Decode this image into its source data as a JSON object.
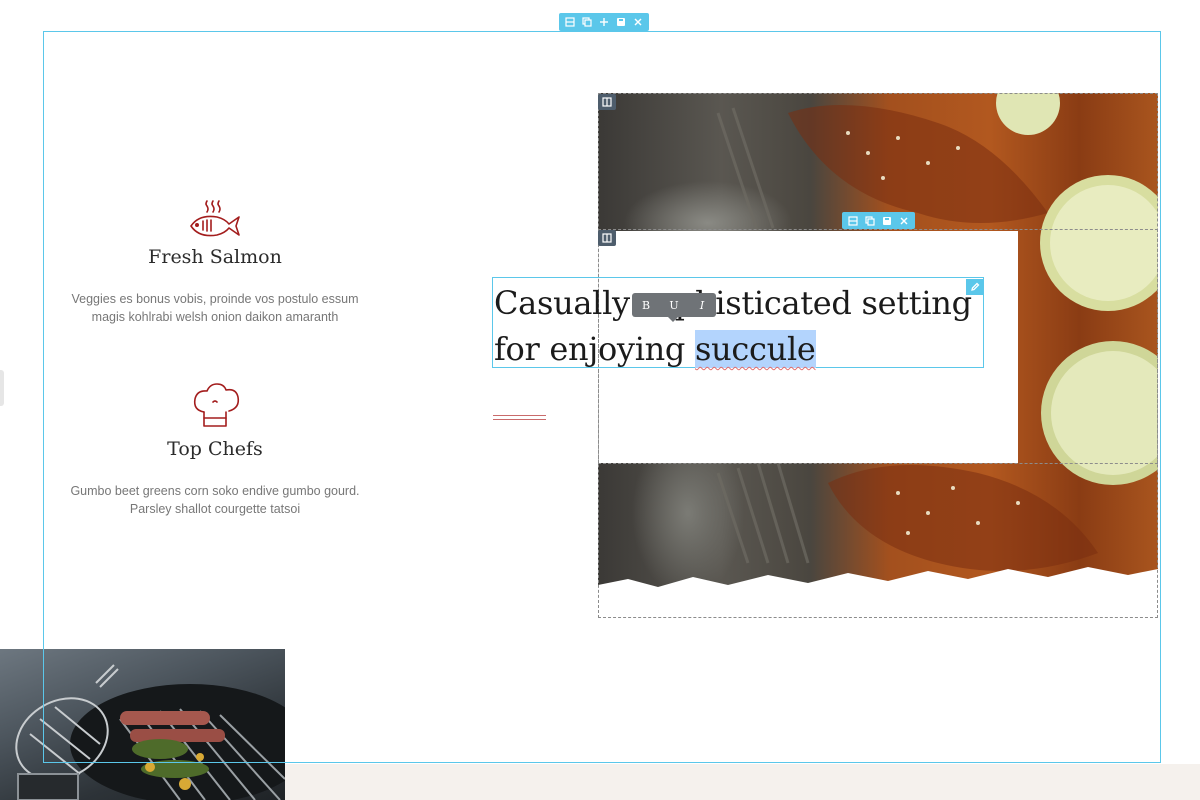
{
  "features": [
    {
      "title": "Fresh Salmon",
      "description": "Veggies es bonus vobis, proinde vos postulo essum magis kohlrabi welsh onion daikon amaranth",
      "icon": "fish-icon"
    },
    {
      "title": "Top Chefs",
      "description": "Gumbo beet greens corn soko endive gumbo gourd. Parsley shallot courgette tatsoi",
      "icon": "chef-hat-icon"
    }
  ],
  "heading": {
    "text_before": "Casually sophisticated setting for enjoying ",
    "selected_text": "succule"
  },
  "format_toolbar": {
    "bold": "B",
    "underline": "U",
    "italic": "I"
  },
  "editor": {
    "section_toolbar_icons": [
      "layout-icon",
      "duplicate-icon",
      "add-icon",
      "save-icon",
      "close-icon"
    ],
    "row_toolbar_icons": [
      "layout-icon",
      "duplicate-icon",
      "save-icon",
      "close-icon"
    ]
  },
  "colors": {
    "accent": "#5bc7ea",
    "brand_red": "#a31d1d",
    "selection": "#b3d4fd",
    "footer_band": "#f5f1ed",
    "column_handle": "#4e5d6c"
  }
}
